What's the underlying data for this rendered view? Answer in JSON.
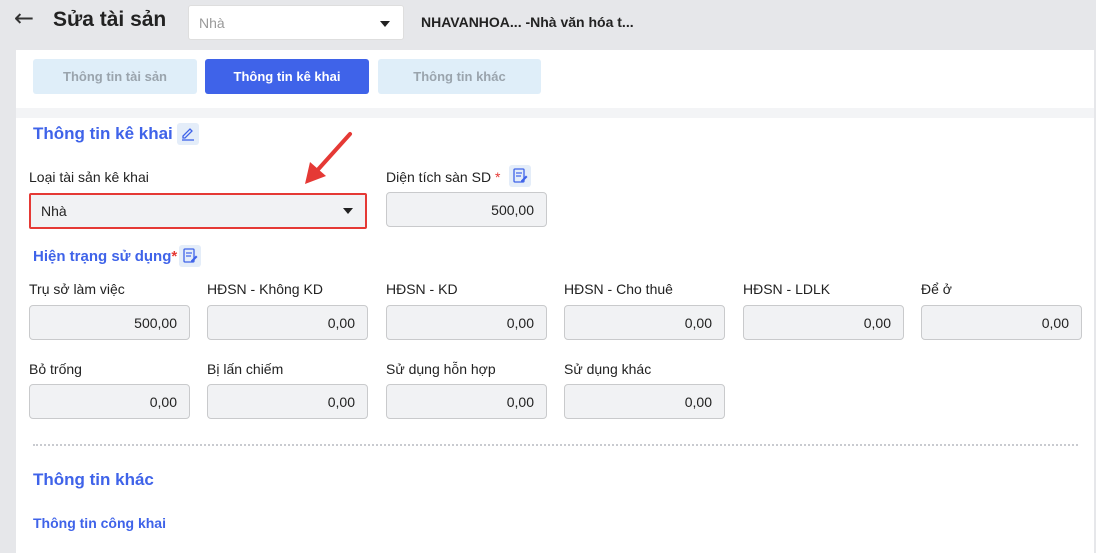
{
  "header": {
    "title": "Sửa tài sản",
    "asset_select_value": "Nhà",
    "asset_name": "NHAVANHOA... -Nhà văn hóa t..."
  },
  "tabs": [
    {
      "label": "Thông tin tài sản",
      "active": false
    },
    {
      "label": "Thông tin kê khai",
      "active": true
    },
    {
      "label": "Thông tin khác",
      "active": false
    }
  ],
  "declaration": {
    "section_title": "Thông tin kê khai",
    "asset_type_label": "Loại tài sản kê khai",
    "asset_type_value": "Nhà",
    "floor_area_label": "Diện tích sàn SD",
    "floor_area_required": "*",
    "floor_area_value": "500,00"
  },
  "usage": {
    "title": "Hiện trạng sử dụng",
    "required": "*",
    "fields": [
      {
        "label": "Trụ sở làm việc",
        "value": "500,00"
      },
      {
        "label": "HĐSN - Không KD",
        "value": "0,00"
      },
      {
        "label": "HĐSN - KD",
        "value": "0,00"
      },
      {
        "label": "HĐSN - Cho thuê",
        "value": "0,00"
      },
      {
        "label": "HĐSN - LDLK",
        "value": "0,00"
      },
      {
        "label": "Để ở",
        "value": "0,00"
      },
      {
        "label": "Bỏ trống",
        "value": "0,00"
      },
      {
        "label": "Bị lấn chiếm",
        "value": "0,00"
      },
      {
        "label": "Sử dụng hỗn hợp",
        "value": "0,00"
      },
      {
        "label": "Sử dụng khác",
        "value": "0,00"
      }
    ]
  },
  "other": {
    "section_title": "Thông tin khác",
    "public_info_title": "Thông tin công khai"
  },
  "colors": {
    "accent": "#3f63e9",
    "highlight": "#e53935"
  }
}
